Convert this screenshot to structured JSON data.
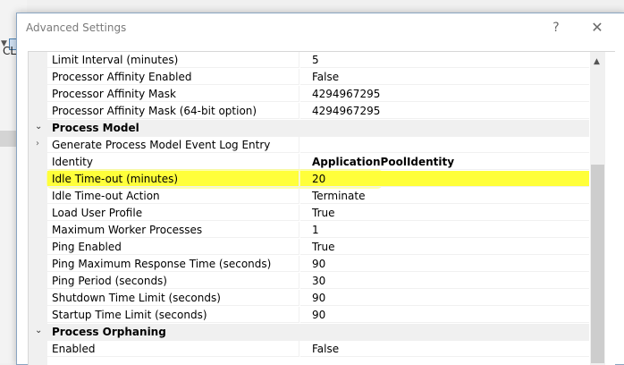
{
  "background": {
    "partial_text": "CLI"
  },
  "dialog": {
    "title": "Advanced Settings",
    "help_label": "?",
    "close_label": "✕"
  },
  "grid": {
    "rows": [
      {
        "name": "Limit Interval (minutes)",
        "value": "5"
      },
      {
        "name": "Processor Affinity Enabled",
        "value": "False"
      },
      {
        "name": "Processor Affinity Mask",
        "value": "4294967295"
      },
      {
        "name": "Processor Affinity Mask (64-bit option)",
        "value": "4294967295"
      },
      {
        "category": "Process Model"
      },
      {
        "name": "Generate Process Model Event Log Entry",
        "value": "",
        "expandable": true
      },
      {
        "name": "Identity",
        "value": "ApplicationPoolIdentity",
        "bold": true
      },
      {
        "name": "Idle Time-out (minutes)",
        "value": "20",
        "highlighted": true
      },
      {
        "name": "Idle Time-out Action",
        "value": "Terminate"
      },
      {
        "name": "Load User Profile",
        "value": "True"
      },
      {
        "name": "Maximum Worker Processes",
        "value": "1"
      },
      {
        "name": "Ping Enabled",
        "value": "True"
      },
      {
        "name": "Ping Maximum Response Time (seconds)",
        "value": "90"
      },
      {
        "name": "Ping Period (seconds)",
        "value": "30"
      },
      {
        "name": "Shutdown Time Limit (seconds)",
        "value": "90"
      },
      {
        "name": "Startup Time Limit (seconds)",
        "value": "90"
      },
      {
        "category": "Process Orphaning"
      },
      {
        "name": "Enabled",
        "value": "False"
      }
    ]
  },
  "colors": {
    "highlight": "#ffff3a",
    "category_bg": "#f0f0f0"
  }
}
